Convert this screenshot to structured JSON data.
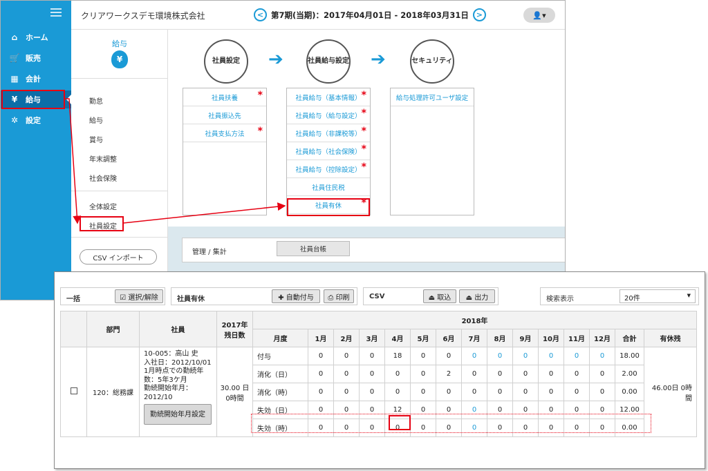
{
  "sidebar": {
    "items": [
      {
        "label": "ホーム",
        "icon": "home-icon"
      },
      {
        "label": "販売",
        "icon": "cart-icon"
      },
      {
        "label": "会計",
        "icon": "calculator-icon"
      },
      {
        "label": "給与",
        "icon": "money-bag-icon"
      },
      {
        "label": "設定",
        "icon": "gear-icon"
      }
    ]
  },
  "header": {
    "company": "クリアワークスデモ環境株式会社",
    "period": "第7期(当期)：2017年04月01日 - 2018年03月31日",
    "prev": "<",
    "next": ">",
    "user_glyph": "👤▾"
  },
  "leftpanel": {
    "title": "給与",
    "bag_symbol": "¥",
    "items": [
      "勤怠",
      "給与",
      "賞与",
      "年末調整",
      "社会保険"
    ],
    "items2": [
      "全体設定",
      "社員設定"
    ],
    "csv_import": "CSV インポート"
  },
  "flow": {
    "steps": [
      "社員設定",
      "社員給与設定",
      "セキュリティ"
    ],
    "col1": [
      "社員扶養",
      "社員振込先",
      "社員支払方法"
    ],
    "col2": [
      "社員給与（基本情報）",
      "社員給与（給与設定）",
      "社員給与（非課税等）",
      "社員給与（社会保険）",
      "社員給与（控除設定）",
      "社員住民税",
      "社員有休"
    ],
    "col3": [
      "給与処理許可ユーザ設定"
    ],
    "required_mark": "*"
  },
  "mgmt": {
    "label": "管理 / 集計",
    "button": "社員台帳"
  },
  "toolbar": {
    "ikkatsu": "一括",
    "select_toggle": "☑ 選択/解除",
    "paid_leave": "社員有休",
    "auto_grant": "✚ 自動付与",
    "print": "⎙ 印刷",
    "csv": "CSV",
    "import": "⏏ 取込",
    "export": "⏏ 出力",
    "search_display": "検索表示",
    "page_size": "20件"
  },
  "table": {
    "headers": {
      "dept": "部門",
      "employee": "社員",
      "remain_2017": "2017年 残日数",
      "year": "2018年",
      "month_type": "月度",
      "months": [
        "1月",
        "2月",
        "3月",
        "4月",
        "5月",
        "6月",
        "7月",
        "8月",
        "9月",
        "10月",
        "11月",
        "12月"
      ],
      "total": "合計",
      "balance": "有休残"
    },
    "row": {
      "dept": "120：総務課",
      "emp_lines": [
        "10-005：高山 史",
        "入社日：2012/10/01",
        "1月時点での勤続年数：5年3ケ月",
        "勤続開始年月：2012/10"
      ],
      "emp_button": "勤続開始年月設定",
      "remain": "30.00 日 0時間",
      "balance": "46.00日 0時間",
      "sub_rows": [
        {
          "label": "付与",
          "values": [
            "0",
            "0",
            "0",
            "18",
            "0",
            "0",
            "0",
            "0",
            "0",
            "0",
            "0",
            "0"
          ],
          "total": "18.00"
        },
        {
          "label": "消化（日）",
          "values": [
            "0",
            "0",
            "0",
            "0",
            "0",
            "2",
            "0",
            "0",
            "0",
            "0",
            "0",
            "0"
          ],
          "total": "2.00"
        },
        {
          "label": "消化（時）",
          "values": [
            "0",
            "0",
            "0",
            "0",
            "0",
            "0",
            "0",
            "0",
            "0",
            "0",
            "0",
            "0"
          ],
          "total": "0.00"
        },
        {
          "label": "失効（日）",
          "values": [
            "0",
            "0",
            "0",
            "12",
            "0",
            "0",
            "0",
            "0",
            "0",
            "0",
            "0",
            "0"
          ],
          "total": "12.00"
        },
        {
          "label": "失効（時）",
          "values": [
            "0",
            "0",
            "0",
            "0",
            "0",
            "0",
            "0",
            "0",
            "0",
            "0",
            "0",
            "0"
          ],
          "total": "0.00"
        }
      ]
    }
  },
  "colors": {
    "accent": "#1a9ad6",
    "sidebar_active": "#0c6ea8",
    "highlight": "#e60012"
  }
}
